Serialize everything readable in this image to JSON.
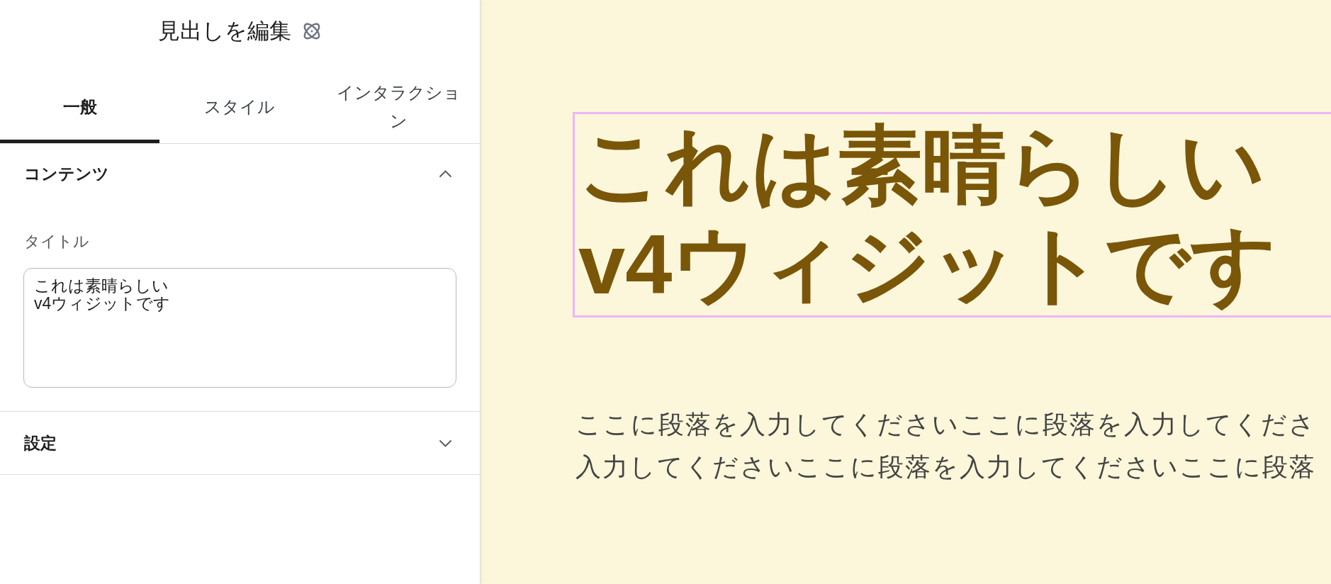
{
  "panel": {
    "title": "見出しを編集",
    "tabs": [
      {
        "label": "一般",
        "selected": true
      },
      {
        "label": "スタイル",
        "selected": false
      },
      {
        "label": "インタラクション",
        "selected": false
      }
    ],
    "sections": [
      {
        "title": "コンテンツ",
        "expanded": true,
        "fields": [
          {
            "label": "タイトル",
            "value": "これは素晴らしい\nv4ウィジットです"
          }
        ]
      },
      {
        "title": "設定",
        "expanded": false
      }
    ]
  },
  "canvas": {
    "heading": {
      "text": "これは素晴らしい\nv4ウィジットです",
      "selected": true
    },
    "paragraph_lines": [
      "ここに段落を入力してくださいここに段落を入力してくださ",
      "入力してくださいここに段落を入力してくださいここに段落"
    ]
  }
}
